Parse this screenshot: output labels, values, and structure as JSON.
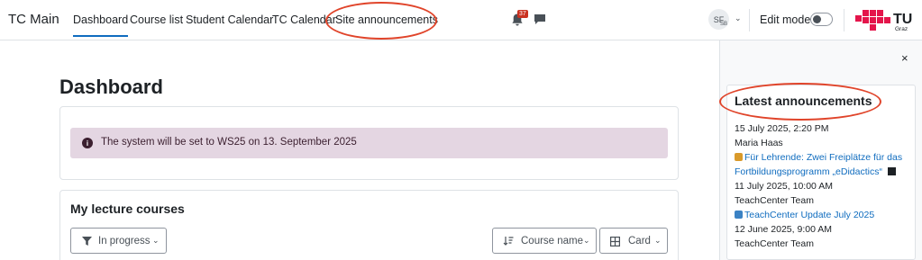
{
  "navbar": {
    "brand": "TC Main",
    "items": [
      {
        "label": "Dashboard",
        "active": true
      },
      {
        "label": "Course list"
      },
      {
        "label": "Student Calendar"
      },
      {
        "label": "TC Calendar"
      },
      {
        "label": "Site announcements"
      }
    ],
    "notification_count": "37",
    "notification_icon": "bell-icon",
    "messages_icon": "chat-bubble-icon",
    "user": {
      "initials": "SF",
      "sub": "SB"
    },
    "edit_mode_label": "Edit mode",
    "edit_mode_on": false,
    "logo_text": "TU",
    "logo_sub": "Graz"
  },
  "main": {
    "title": "Dashboard",
    "alert_text": "The system will be set to WS25 on 13. September 2025",
    "alert_icon": "info-icon",
    "courses_heading": "My lecture courses",
    "filter_label": "In progress",
    "sort_label": "Course name",
    "view_label": "Card"
  },
  "drawer": {
    "close_symbol": "×",
    "block_title": "Latest announcements",
    "announcements": [
      {
        "date": "15 July 2025, 2:20 PM",
        "author": "Maria Haas",
        "title": "Für Lehrende: Zwei Freiplätze für das",
        "title_cont": "Fortbildungsprogramm „eDidactics“"
      },
      {
        "date": "11 July 2025, 10:00 AM",
        "author": "TeachCenter Team",
        "title": "TeachCenter Update July 2025"
      },
      {
        "date": "12 June 2025, 9:00 AM",
        "author": "TeachCenter Team"
      }
    ]
  },
  "colors": {
    "accent": "#0f6cbf",
    "alert_bg": "#e4d6e2",
    "badge": "#ca3120",
    "highlight": "#e0442a",
    "logo_red": "#e4154b"
  }
}
